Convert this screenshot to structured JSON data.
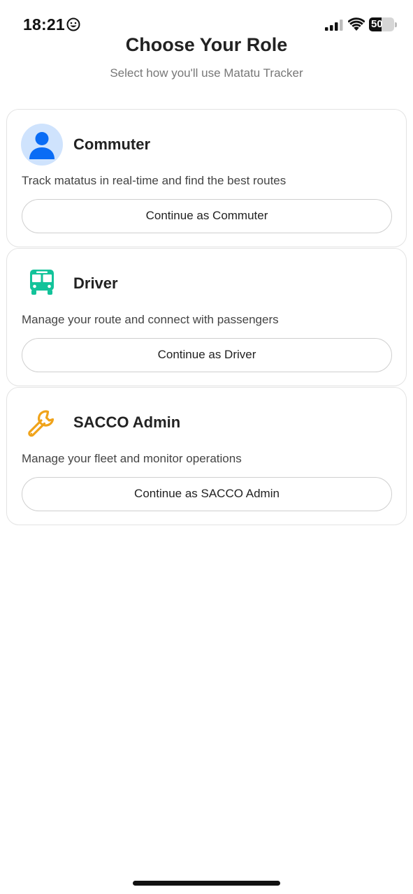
{
  "status_bar": {
    "time": "18:21",
    "battery_level": "50",
    "icons": [
      "smiley-icon",
      "signal-icon",
      "wifi-icon",
      "battery-icon"
    ]
  },
  "header": {
    "title": "Choose Your Role",
    "subtitle": "Select how you'll use Matatu Tracker"
  },
  "roles": [
    {
      "title": "Commuter",
      "description": "Track matatus in real-time and find the best routes",
      "button_label": "Continue as Commuter",
      "icon": "person-icon",
      "accent": "#0a6cf5"
    },
    {
      "title": "Driver",
      "description": "Manage your route and connect with passengers",
      "button_label": "Continue as Driver",
      "icon": "bus-icon",
      "accent": "#12c39a"
    },
    {
      "title": "SACCO Admin",
      "description": "Manage your fleet and monitor operations",
      "button_label": "Continue as SACCO Admin",
      "icon": "wrench-icon",
      "accent": "#f0a31a"
    }
  ]
}
